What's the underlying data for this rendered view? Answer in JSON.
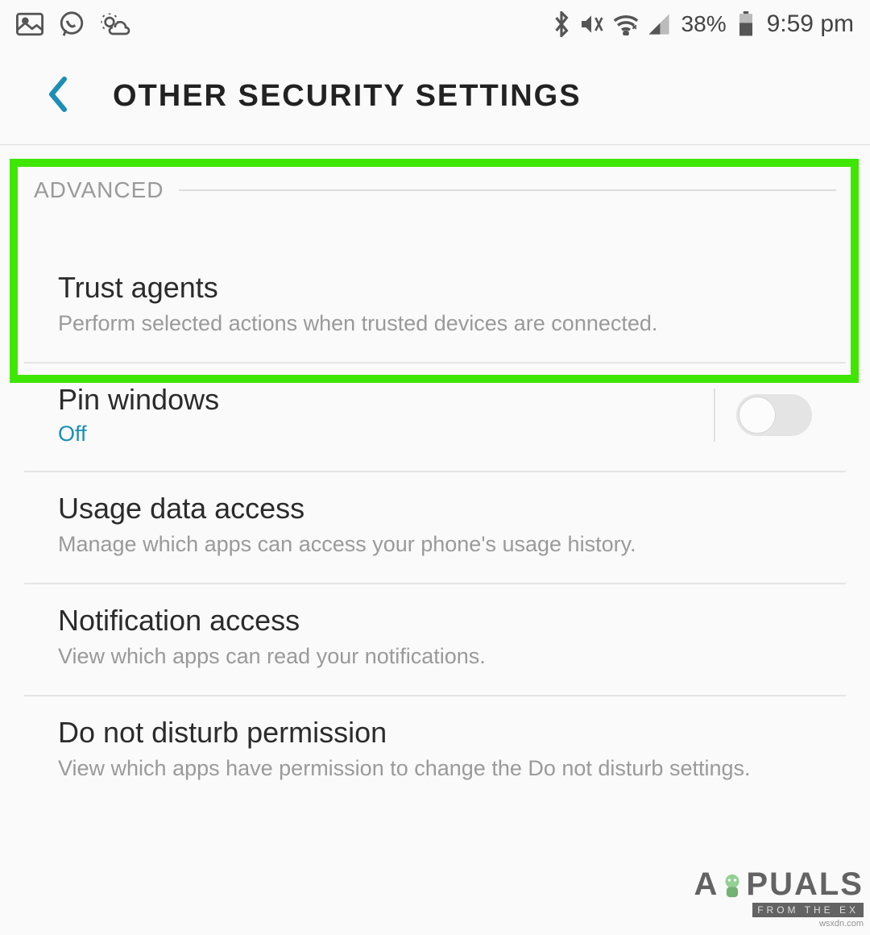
{
  "status_bar": {
    "battery_percent": "38%",
    "time": "9:59 pm",
    "icons_left": [
      "gallery-icon",
      "whatsapp-icon",
      "weather-icon"
    ],
    "icons_right": [
      "bluetooth-icon",
      "mute-icon",
      "wifi-icon",
      "signal-icon",
      "battery-icon"
    ]
  },
  "header": {
    "title": "OTHER SECURITY SETTINGS"
  },
  "section": {
    "label": "ADVANCED"
  },
  "items": [
    {
      "title": "Trust agents",
      "desc": "Perform selected actions when trusted devices are connected.",
      "highlighted": true
    },
    {
      "title": "Pin windows",
      "status": "Off",
      "toggle": false
    },
    {
      "title": "Usage data access",
      "desc": "Manage which apps can access your phone's usage history."
    },
    {
      "title": "Notification access",
      "desc": "View which apps can read your notifications."
    },
    {
      "title": "Do not disturb permission",
      "desc": "View which apps have permission to change the Do not disturb settings."
    }
  ],
  "watermark": {
    "brand": "APPUALS",
    "tag": "FROM THE EX",
    "src": "wsxdn.com"
  }
}
